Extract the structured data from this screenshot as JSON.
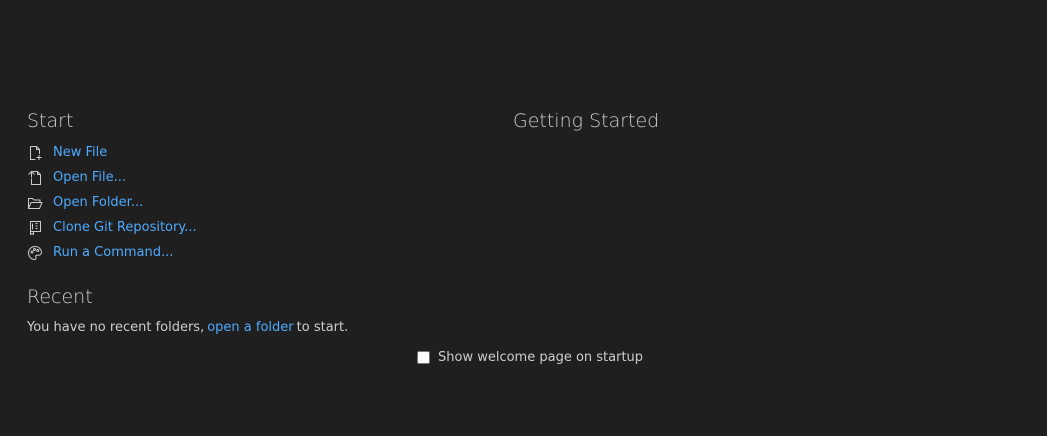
{
  "start": {
    "title": "Start",
    "items": [
      {
        "label": "New File",
        "icon": "new-file-icon"
      },
      {
        "label": "Open File...",
        "icon": "open-file-icon"
      },
      {
        "label": "Open Folder...",
        "icon": "open-folder-icon"
      },
      {
        "label": "Clone Git Repository...",
        "icon": "git-repo-icon"
      },
      {
        "label": "Run a Command...",
        "icon": "palette-icon"
      }
    ]
  },
  "recent": {
    "title": "Recent",
    "text_before": "You have no recent folders,",
    "link": "open a folder",
    "text_after": "to start."
  },
  "getting_started": {
    "title": "Getting Started"
  },
  "footer": {
    "checkbox_label": "Show welcome page on startup",
    "checked": false
  },
  "colors": {
    "background": "#1f1f1f",
    "link": "#4daafc",
    "text": "#cccccc"
  }
}
